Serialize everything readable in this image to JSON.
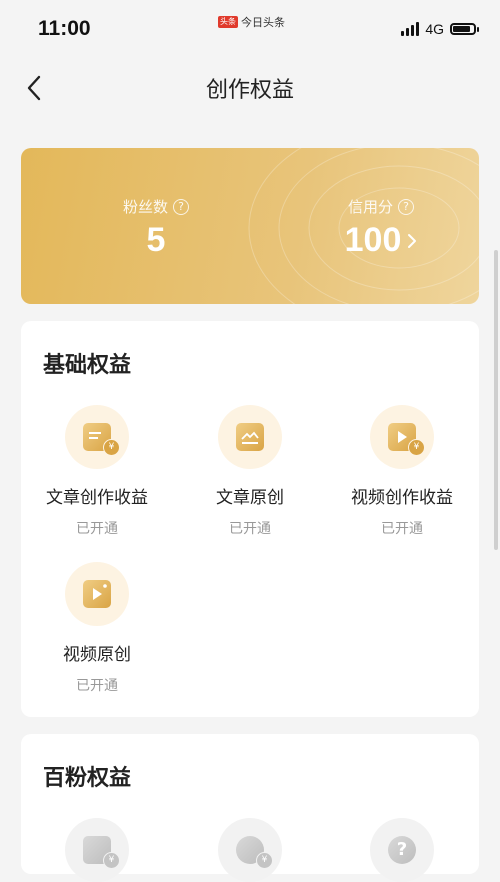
{
  "status_bar": {
    "time": "11:00",
    "app_badge": "头条",
    "app_name": "今日头条",
    "network": "4G",
    "battery_level": 0.85
  },
  "header": {
    "title": "创作权益"
  },
  "stats": {
    "fans_label": "粉丝数",
    "fans_value": "5",
    "credit_label": "信用分",
    "credit_value": "100",
    "help_glyph": "?"
  },
  "basic": {
    "title": "基础权益",
    "items": [
      {
        "name": "文章创作收益",
        "status": "已开通",
        "icon": "article-revenue-icon"
      },
      {
        "name": "文章原创",
        "status": "已开通",
        "icon": "article-original-icon"
      },
      {
        "name": "视频创作收益",
        "status": "已开通",
        "icon": "video-revenue-icon"
      },
      {
        "name": "视频原创",
        "status": "已开通",
        "icon": "video-original-icon"
      }
    ]
  },
  "hundred": {
    "title": "百粉权益",
    "coin_glyph": "¥",
    "help_glyph": "?"
  },
  "colors": {
    "gold": "#e3b85a",
    "gold_dark": "#d9a445",
    "icon_bg": "#fdf3e2",
    "muted": "#999999"
  }
}
